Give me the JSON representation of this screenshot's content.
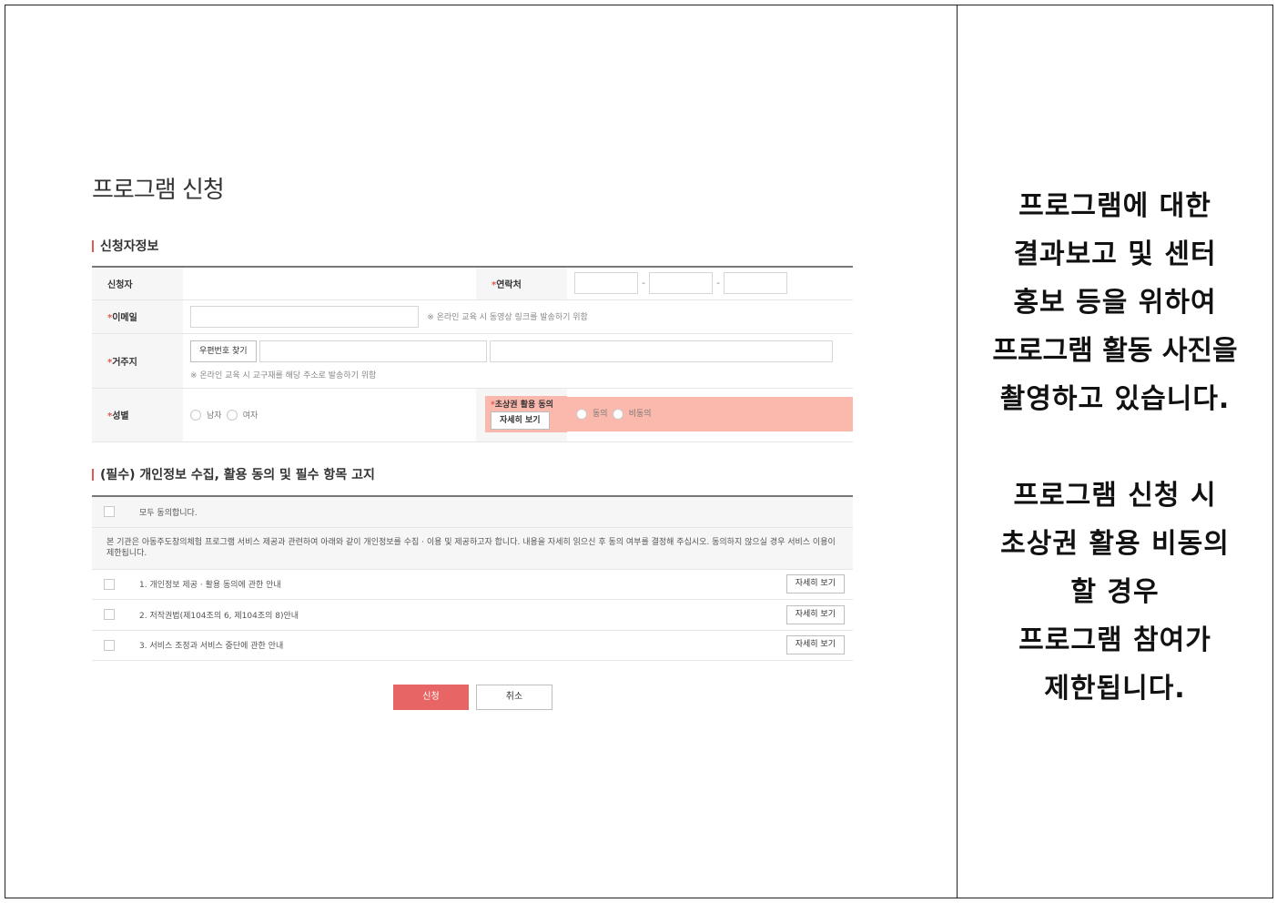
{
  "page": {
    "title": "프로그램 신청"
  },
  "applicant_section": {
    "title": "신청자정보",
    "applicant_label": "신청자",
    "contact_label": "연락처",
    "email_label": "이메일",
    "email_note": "※ 온라인 교육 시 동영상 링크를 발송하기 위함",
    "address_label": "거주지",
    "zip_button": "우편번호 찾기",
    "address_note": "※ 온라인 교육 시 교구재를 해당 주소로 발송하기 위함",
    "gender_label": "성별",
    "gender_options": [
      "남자",
      "여자"
    ],
    "portrait_label": "초상권 활용 동의",
    "portrait_detail_button": "자세히 보기",
    "portrait_options": [
      "동의",
      "비동의"
    ],
    "highlight_color": "#fbb9ae"
  },
  "privacy_section": {
    "title": "(필수) 개인정보 수집, 활용 동의 및 필수 항목 고지",
    "agree_all": "모두 동의합니다.",
    "notice": "본 기관은 아동주도창의체험 프로그램 서비스 제공과 관련하여 아래와 같이 개인정보를 수집 · 이용 및 제공하고자 합니다. 내용을 자세히 읽으신 후 동의 여부를 결정해 주십시오. 동의하지 않으실 경우 서비스 이용이 제한됩니다.",
    "items": [
      {
        "label": "1. 개인정보 제공 · 활용 동의에 관한 안내",
        "button": "자세히 보기"
      },
      {
        "label": "2. 저작권법(제104조의 6, 제104조의 8)안내",
        "button": "자세히 보기"
      },
      {
        "label": "3. 서비스 조정과 서비스 중단에 관한 안내",
        "button": "자세히 보기"
      }
    ]
  },
  "actions": {
    "submit": "신청",
    "cancel": "취소",
    "submit_color": "#e86565"
  },
  "side_notice": {
    "lines_1": [
      "프로그램에 대한",
      "결과보고 및 센터",
      "홍보 등을 위하여",
      "프로그램 활동 사진을",
      "촬영하고 있습니다."
    ],
    "lines_2": [
      "프로그램 신청 시",
      "초상권 활용 비동의",
      "할 경우",
      "프로그램 참여가",
      "제한됩니다."
    ]
  }
}
